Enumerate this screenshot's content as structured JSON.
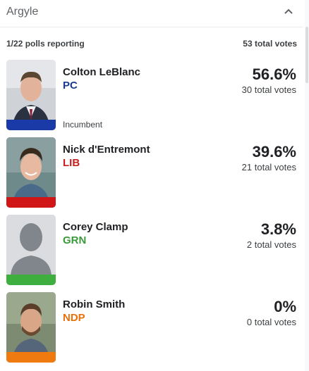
{
  "header": {
    "title": "Argyle",
    "collapse_icon": "chevron-up-icon"
  },
  "summary": {
    "polls": "1/22 polls reporting",
    "total": "53 total votes"
  },
  "candidates": [
    {
      "name": "Colton LeBlanc",
      "party": "PC",
      "party_color": "#1a3a8f",
      "bar_color": "#1a3aa8",
      "percent": "56.6%",
      "votes": "30 total votes",
      "note": "Incumbent"
    },
    {
      "name": "Nick d'Entremont",
      "party": "LIB",
      "party_color": "#c5221f",
      "bar_color": "#d01616",
      "percent": "39.6%",
      "votes": "21 total votes"
    },
    {
      "name": "Corey Clamp",
      "party": "GRN",
      "party_color": "#3a9a3a",
      "bar_color": "#3eae3e",
      "percent": "3.8%",
      "votes": "2 total votes"
    },
    {
      "name": "Robin Smith",
      "party": "NDP",
      "party_color": "#e8710a",
      "bar_color": "#ee7a10",
      "percent": "0%",
      "votes": "0 total votes"
    }
  ]
}
